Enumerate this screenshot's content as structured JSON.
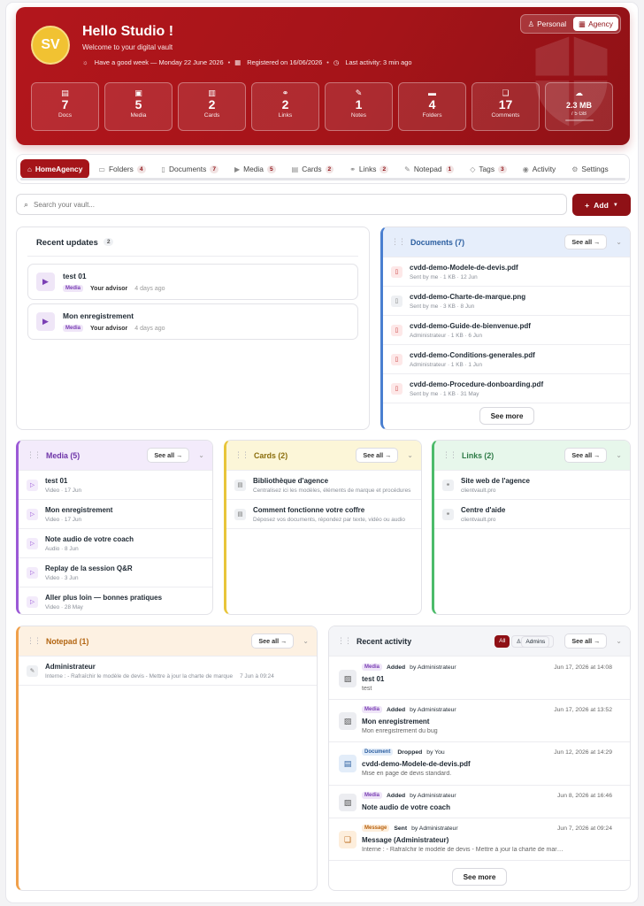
{
  "hero": {
    "initials": "SV",
    "greeting": "Hello Studio !",
    "welcome": "Welcome to your digital vault",
    "meta_week": "Have a good week — Monday 22 June 2026",
    "meta_registered": "Registered on 16/06/2026",
    "meta_activity": "Last activity: 3 min ago",
    "mode_personal": "Personal",
    "mode_agency": "Agency",
    "stats": [
      {
        "icon": "doc-icon",
        "glyph": "▤",
        "value": "7",
        "label": "Docs"
      },
      {
        "icon": "media-icon",
        "glyph": "▣",
        "value": "5",
        "label": "Media"
      },
      {
        "icon": "cards-icon",
        "glyph": "▥",
        "value": "2",
        "label": "Cards"
      },
      {
        "icon": "link-icon",
        "glyph": "⚭",
        "value": "2",
        "label": "Links"
      },
      {
        "icon": "note-icon",
        "glyph": "✎",
        "value": "1",
        "label": "Notes"
      },
      {
        "icon": "folder-icon",
        "glyph": "▬",
        "value": "4",
        "label": "Folders"
      },
      {
        "icon": "comments-icon",
        "glyph": "❏",
        "value": "17",
        "label": "Comments"
      }
    ],
    "storage": {
      "value": "2.3 MB",
      "label": "/ 5 GB",
      "used_fraction": 0.0005
    }
  },
  "tabs": [
    {
      "label": "HomeAgency",
      "count": "",
      "glyph": "⌂"
    },
    {
      "label": "Folders",
      "count": "4",
      "glyph": "▭"
    },
    {
      "label": "Documents",
      "count": "7",
      "glyph": "▯"
    },
    {
      "label": "Media",
      "count": "5",
      "glyph": "▶"
    },
    {
      "label": "Cards",
      "count": "2",
      "glyph": "▤"
    },
    {
      "label": "Links",
      "count": "2",
      "glyph": "⚭"
    },
    {
      "label": "Notepad",
      "count": "1",
      "glyph": "✎"
    },
    {
      "label": "Tags",
      "count": "3",
      "glyph": "◇"
    },
    {
      "label": "Activity",
      "count": "",
      "glyph": "◉"
    },
    {
      "label": "Settings",
      "count": "",
      "glyph": "⚙"
    }
  ],
  "search": {
    "placeholder": "Search your vault..."
  },
  "add_label": "Add",
  "recent_updates": {
    "title": "Recent updates",
    "count": "2",
    "items": [
      {
        "title": "test 01",
        "tag": "Media",
        "by": "Your advisor",
        "ago": "4 days ago"
      },
      {
        "title": "Mon enregistrement",
        "tag": "Media",
        "by": "Your advisor",
        "ago": "4 days ago"
      }
    ]
  },
  "see_all": "See all →",
  "see_more": "See more",
  "documents": {
    "title": "Documents (7)",
    "items": [
      {
        "name": "cvdd-demo-Modele-de-devis.pdf",
        "sub": "Sent by me · 1 KB · 12 Jun"
      },
      {
        "name": "cvdd-demo-Charte-de-marque.png",
        "sub": "Sent by me · 3 KB · 8 Jun"
      },
      {
        "name": "cvdd-demo-Guide-de-bienvenue.pdf",
        "sub": "Administrateur · 1 KB · 6 Jun"
      },
      {
        "name": "cvdd-demo-Conditions-generales.pdf",
        "sub": "Administrateur · 1 KB · 1 Jun"
      },
      {
        "name": "cvdd-demo-Procedure-donboarding.pdf",
        "sub": "Sent by me · 1 KB · 31 May"
      }
    ]
  },
  "media": {
    "title": "Media (5)",
    "items": [
      {
        "name": "test 01",
        "sub": "Video · 17 Jun"
      },
      {
        "name": "Mon enregistrement",
        "sub": "Video · 17 Jun"
      },
      {
        "name": "Note audio de votre coach",
        "sub": "Audio · 8 Jun"
      },
      {
        "name": "Replay de la session Q&R",
        "sub": "Video · 3 Jun"
      },
      {
        "name": "Aller plus loin — bonnes pratiques",
        "sub": "Video · 28 May"
      }
    ]
  },
  "cards": {
    "title": "Cards (2)",
    "items": [
      {
        "name": "Bibliothèque d'agence",
        "sub": "Centralisez ici les modèles, éléments de marque et procédures"
      },
      {
        "name": "Comment fonctionne votre coffre",
        "sub": "Déposez vos documents, répondez par texte, vidéo ou audio"
      }
    ]
  },
  "links": {
    "title": "Links (2)",
    "items": [
      {
        "name": "Site web de l'agence",
        "sub": "clientvault.pro"
      },
      {
        "name": "Centre d'aide",
        "sub": "clientvault.pro"
      }
    ]
  },
  "notepad": {
    "title": "Notepad (1)",
    "items": [
      {
        "name": "Administrateur",
        "sub": "Interne : - Rafraîchir le modèle de devis - Mettre à jour la charte de marque",
        "date": "7 Jun à 09:24"
      }
    ]
  },
  "activity": {
    "title": "Recent activity",
    "filter_all": "All",
    "filter_admins": "Admins",
    "items": [
      {
        "tag": "Media",
        "action": "Added",
        "by": "by Administrateur",
        "date": "Jun 17, 2026 at 14:08",
        "title": "test 01",
        "sub": "test",
        "kind": "media"
      },
      {
        "tag": "Media",
        "action": "Added",
        "by": "by Administrateur",
        "date": "Jun 17, 2026 at 13:52",
        "title": "Mon enregistrement",
        "sub": "Mon enregistrement du bug",
        "kind": "media"
      },
      {
        "tag": "Document",
        "action": "Dropped",
        "by": "by You",
        "date": "Jun 12, 2026 at 14:29",
        "title": "cvdd-demo-Modele-de-devis.pdf",
        "sub": "Mise en page de devis standard.",
        "kind": "doc"
      },
      {
        "tag": "Media",
        "action": "Added",
        "by": "by Administrateur",
        "date": "Jun 8, 2026 at 16:46",
        "title": "Note audio de votre coach",
        "sub": "",
        "kind": "media"
      },
      {
        "tag": "Message",
        "action": "Sent",
        "by": "by Administrateur",
        "date": "Jun 7, 2026 at 09:24",
        "title": "Message (Administrateur)",
        "sub": "Interne : - Rafraîchir le modèle de devis - Mettre à jour la charte de marque",
        "kind": "msg"
      }
    ]
  },
  "colors": {
    "brand": "#a51419",
    "brand_dark": "#8f1116",
    "docs_accent": "#4a7fd0",
    "media_accent": "#9b59d6",
    "cards_accent": "#e8c53a",
    "links_accent": "#4cbb6a",
    "notepad_accent": "#f0a04b"
  }
}
